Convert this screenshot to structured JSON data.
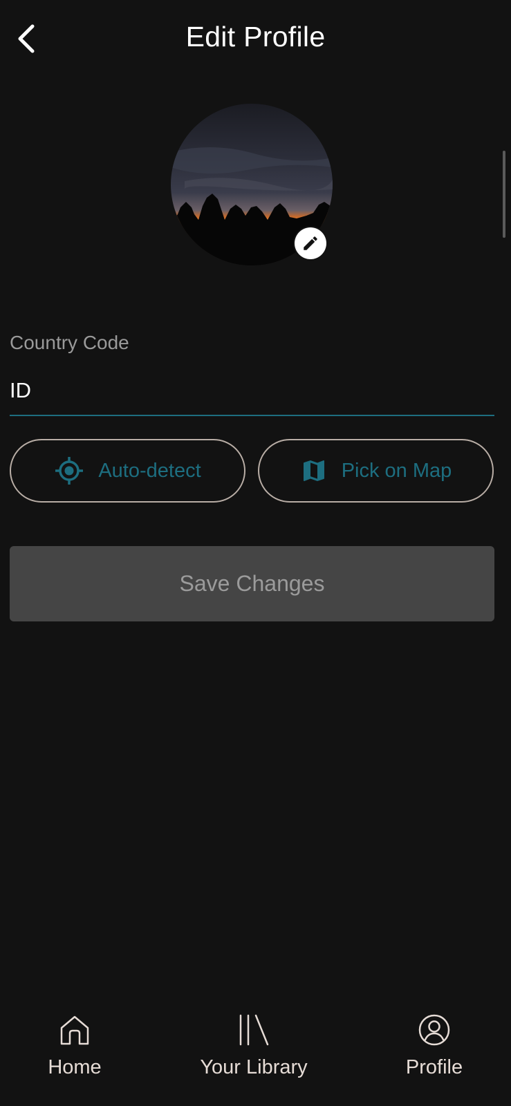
{
  "header": {
    "title": "Edit Profile",
    "back_icon": "chevron-left-icon"
  },
  "avatar": {
    "edit_icon": "pencil-icon"
  },
  "form": {
    "country_code_label": "Country Code",
    "country_code_value": "ID"
  },
  "actions": {
    "auto_detect_label": "Auto-detect",
    "auto_detect_icon": "crosshair-location-icon",
    "pick_on_map_label": "Pick on Map",
    "pick_on_map_icon": "map-icon",
    "save_label": "Save Changes"
  },
  "bottom_nav": {
    "items": [
      {
        "label": "Home",
        "icon": "home-icon"
      },
      {
        "label": "Your Library",
        "icon": "library-icon"
      },
      {
        "label": "Profile",
        "icon": "profile-icon"
      }
    ]
  },
  "colors": {
    "background": "#121212",
    "accent": "#1d6e80",
    "button_outline": "#b9aea6",
    "save_bg": "#454545",
    "save_text": "#9b9b9b",
    "nav_text": "#e6dcd6"
  }
}
